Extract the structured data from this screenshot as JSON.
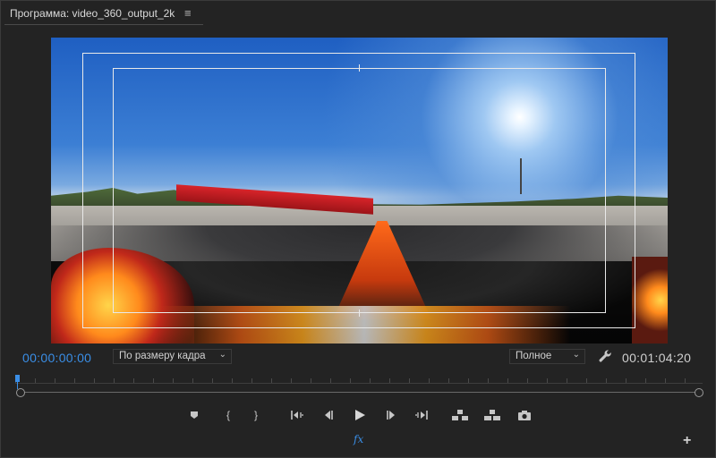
{
  "window": {
    "title": "Программа: video_360_output_2k",
    "menu_icon": "hamburger-icon"
  },
  "viewer": {
    "content": "360-video-frame",
    "safe_margins": true
  },
  "controls": {
    "timecode_current": "00:00:00:00",
    "timecode_duration": "00:01:04:20",
    "fit_select": "По размеру кадра",
    "quality_select": "Полное",
    "settings_icon": "wrench-icon"
  },
  "transport": {
    "buttons": [
      "add-marker-icon",
      "mark-in-icon",
      "mark-out-icon",
      "go-to-in-icon",
      "step-back-icon",
      "play-icon",
      "step-forward-icon",
      "go-to-out-icon",
      "lift-icon",
      "extract-icon",
      "export-frame-icon"
    ]
  },
  "footer": {
    "fx_label": "fx",
    "add_label": "+"
  },
  "colors": {
    "accent": "#3a8ee6",
    "panel": "#232323",
    "text": "#c8c8c8"
  }
}
